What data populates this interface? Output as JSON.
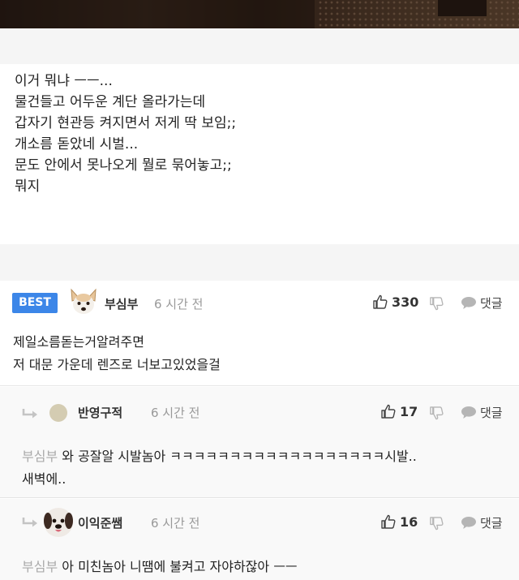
{
  "post": {
    "lines": [
      "이거 뭐냐 ㅡㅡ...",
      "물건들고 어두운 계단 올라가는데",
      "갑자기 현관등 켜지면서 저게 딱 보임;;",
      "개소름 돋았네 시벌...",
      "문도 안에서 못나오게 뭘로 묶어놓고;;",
      "뭐지"
    ]
  },
  "best_comment": {
    "badge": "BEST",
    "author": "부심부",
    "time": "6 시간 전",
    "likes": "330",
    "reply_label": "댓글",
    "lines": [
      "제일소름돋는거알려주면",
      "저 대문 가운데 렌즈로 너보고있었을걸"
    ]
  },
  "replies": [
    {
      "author": "반영구적",
      "time": "6 시간 전",
      "likes": "17",
      "reply_label": "댓글",
      "mention": "부심부",
      "line1": " 와 공잘알 시발놈아 ㅋㅋㅋㅋㅋㅋㅋㅋㅋㅋㅋㅋㅋㅋㅋㅋㅋㅋ시발..",
      "line2": "새벽에.."
    },
    {
      "author": "이익준쌤",
      "time": "6 시간 전",
      "likes": "16",
      "reply_label": "댓글",
      "mention": "부심부",
      "line1": " 아 미친놈아 니땜에 불켜고 자야하잖아 ㅡㅡ"
    }
  ],
  "colors": {
    "best_badge": "#3c86e8",
    "muted_text": "#999999",
    "section_gap": "#f5f5f5"
  },
  "icons": [
    "thumbs-up-icon",
    "thumbs-down-icon",
    "speech-bubble-icon",
    "reply-arrow-icon"
  ]
}
